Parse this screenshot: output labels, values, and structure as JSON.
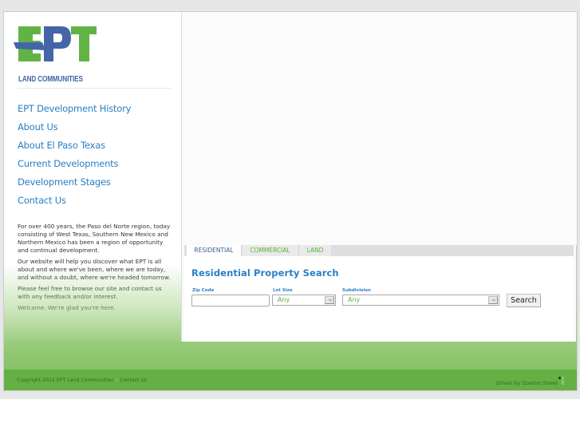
{
  "brand": {
    "logo_letters": "EPT",
    "logo_subtitle": "LAND COMMUNITIES",
    "colors": {
      "green": "#62b346",
      "blue": "#4466a8",
      "link_blue": "#2a7fc4",
      "footer_green": "#65b045"
    }
  },
  "nav": {
    "items": [
      {
        "label": "EPT Development History"
      },
      {
        "label": "About Us"
      },
      {
        "label": "About El Paso Texas"
      },
      {
        "label": "Current Developments"
      },
      {
        "label": "Development Stages"
      },
      {
        "label": "Contact Us"
      }
    ]
  },
  "intro": {
    "paragraphs": [
      "For over 400 years, the Paso del Norte region, today consisting of West Texas, Southern New Mexico and Northern Mexico has been a region of opportunity and continual development.",
      "Our website will help you discover what EPT is all about and where we've been, where we are today, and without a doubt, where we're headed tomorrow.",
      "Please feel free to browse our site and contact us with any feedback and/or interest.",
      "Welcome. We're glad you're here."
    ]
  },
  "search": {
    "tabs": [
      {
        "label": "RESIDENTIAL",
        "active": true
      },
      {
        "label": "COMMERCIAL",
        "active": false
      },
      {
        "label": "LAND",
        "active": false
      }
    ],
    "title": "Residential Property Search",
    "zip_label": "Zip Code",
    "zip_value": "",
    "lot_label": "Lot Size",
    "lot_value": "Any",
    "subdivision_label": "Subdivision",
    "subdivision_value": "Any",
    "button_label": "Search"
  },
  "footer": {
    "copyright": "Copyright 2011 EPT Land Communities",
    "separator": "|",
    "contact_link": "Contact Us",
    "credit": "Driven by Stanton Street"
  }
}
